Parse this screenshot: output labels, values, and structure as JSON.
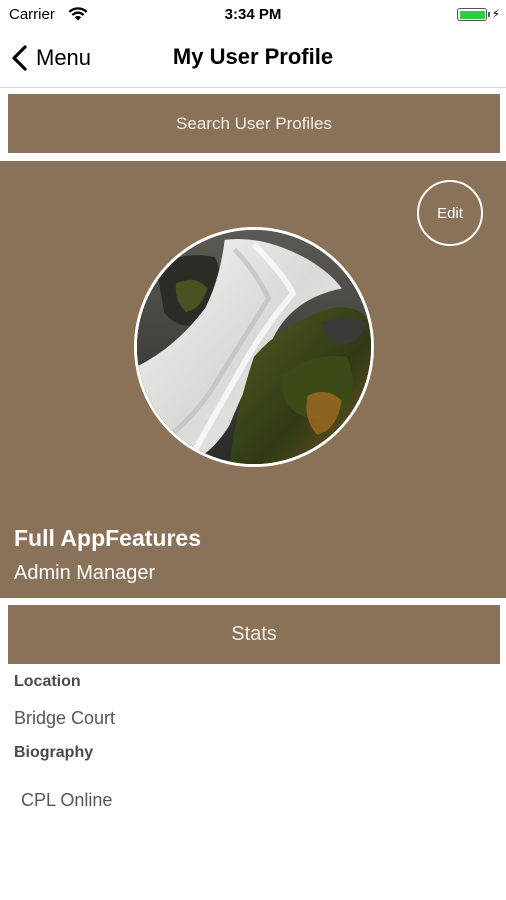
{
  "status_bar": {
    "carrier": "Carrier",
    "time": "3:34 PM",
    "battery_level": 1.0,
    "battery_color": "#2ecc40",
    "wifi_icon": "wifi-icon",
    "charging_icon": "bolt-icon"
  },
  "nav": {
    "back_label": "Menu",
    "back_icon": "chevron-left-icon",
    "title": "My User Profile"
  },
  "search": {
    "label": "Search User Profiles"
  },
  "profile": {
    "edit_label": "Edit",
    "name": "Full AppFeatures",
    "role": "Admin Manager",
    "avatar_description": "waterfall photo"
  },
  "stats": {
    "label": "Stats"
  },
  "details": {
    "location_label": "Location",
    "location_value": "Bridge Court",
    "biography_label": "Biography",
    "biography_value": "CPL Online"
  },
  "colors": {
    "accent": "#8a7259",
    "text_on_accent": "#ffffff",
    "label": "#4a4a4a",
    "value": "#555555"
  }
}
